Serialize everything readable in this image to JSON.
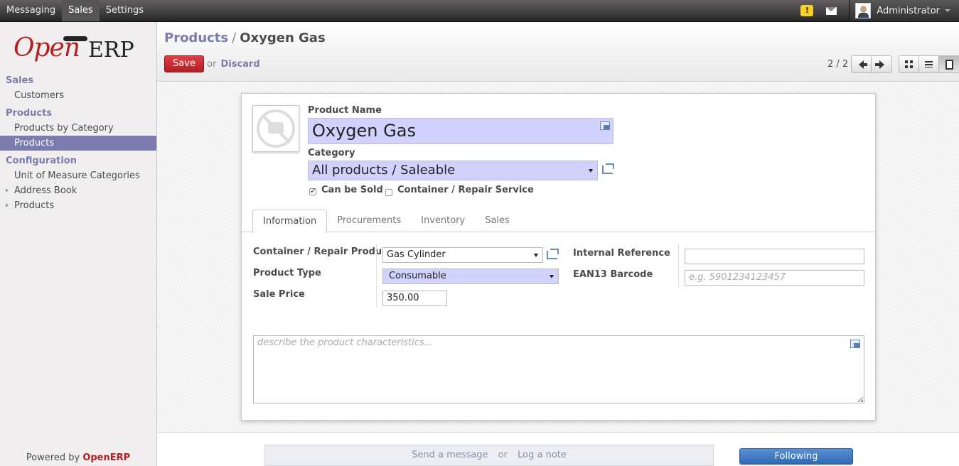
{
  "topbar": {
    "menu": [
      "Messaging",
      "Sales",
      "Settings"
    ],
    "active_menu": "Sales",
    "user_name": "Administrator"
  },
  "sidebar": {
    "logo_open": "Open",
    "logo_erp": "ERP",
    "sections": [
      {
        "head": "Sales",
        "items": [
          "Customers"
        ]
      },
      {
        "head": "Products",
        "items": [
          "Products by Category",
          "Products"
        ]
      },
      {
        "head": "Configuration",
        "items": [
          "Unit of Measure Categories",
          "Address Book",
          "Products"
        ]
      }
    ],
    "powered_prefix": "Powered by",
    "powered_brand": "OpenERP"
  },
  "header": {
    "breadcrumb_parent": "Products",
    "breadcrumb_sep": "/",
    "breadcrumb_current": "Oxygen Gas",
    "save_label": "Save",
    "or_text": "or",
    "discard_label": "Discard",
    "pager": "2 / 2"
  },
  "form": {
    "product_name_label": "Product Name",
    "product_name_value": "Oxygen Gas",
    "category_label": "Category",
    "category_value": "All products / Saleable",
    "can_be_sold_label": "Can be Sold",
    "can_be_sold": true,
    "container_service_label": "Container / Repair Service",
    "container_service": false,
    "tabs": [
      "Information",
      "Procurements",
      "Inventory",
      "Sales"
    ],
    "active_tab": "Information",
    "container_product_label": "Container / Repair Product",
    "container_product_value": "Gas Cylinder",
    "product_type_label": "Product Type",
    "product_type_value": "Consumable",
    "sale_price_label": "Sale Price",
    "sale_price_value": "350.00",
    "internal_ref_label": "Internal Reference",
    "internal_ref_value": "",
    "ean13_label": "EAN13 Barcode",
    "ean13_placeholder": "e.g. 5901234123457",
    "description_placeholder": "describe the product characteristics..."
  },
  "chatter": {
    "send_message": "Send a message",
    "or_text": "or",
    "log_note": "Log a note",
    "following_label": "Following"
  }
}
